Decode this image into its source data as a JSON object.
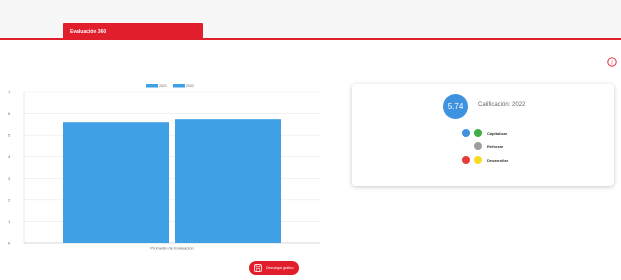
{
  "tabs": [
    {
      "label": "Evaluación 360"
    }
  ],
  "card": {
    "score": "5.74",
    "caption": "Calificación: 2022",
    "legend": [
      {
        "label": "Capitalizar",
        "colors": [
          "#3e93e0",
          "#3fae49"
        ]
      },
      {
        "label": "Reforzar",
        "colors": [
          "#9e9e9e"
        ]
      },
      {
        "label": "Desarrollar",
        "colors": [
          "#e83b3b",
          "#f6dc26"
        ]
      }
    ]
  },
  "download_button": {
    "label": "Descargar gráfico"
  },
  "chart_data": {
    "type": "bar",
    "categories": [
      "Promedio de Evaluación"
    ],
    "series": [
      {
        "name": "2021",
        "values": [
          5.6
        ],
        "color": "#3fa0e6"
      },
      {
        "name": "2022",
        "values": [
          5.74
        ],
        "color": "#3fa0e6"
      }
    ],
    "ylim": [
      0,
      7
    ],
    "yticks": [
      0,
      1,
      2,
      3,
      4,
      5,
      6,
      7
    ],
    "grid": true,
    "legend_position": "top-center"
  }
}
